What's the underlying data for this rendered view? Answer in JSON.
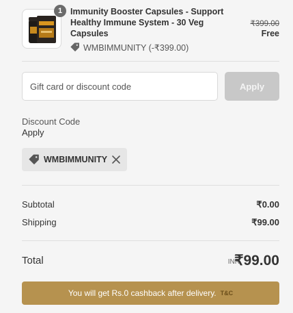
{
  "product": {
    "quantity": "1",
    "name": "Immunity Booster Capsules - Support Healthy Immune System - 30 Veg Capsules",
    "discount_line": "WMBIMMUNITY (-₹399.00)",
    "original_price": "₹399.00",
    "price": "Free"
  },
  "discount_form": {
    "placeholder": "Gift card or discount code",
    "value": "",
    "apply_label": "Apply"
  },
  "discount_section": {
    "label": "Discount Code",
    "sub_label": "Apply",
    "applied_code": "WMBIMMUNITY"
  },
  "summary": {
    "subtotal_label": "Subtotal",
    "subtotal_value": "₹0.00",
    "shipping_label": "Shipping",
    "shipping_value": "₹99.00",
    "total_label": "Total",
    "currency": "INR",
    "total_value": "₹99.00"
  },
  "cashback": {
    "message": "You will get Rs.0 cashback after delivery.",
    "tc_label": "T&C"
  },
  "colors": {
    "background": "#f5f5f5",
    "apply_button_disabled": "#c8c8c8",
    "cashback_banner": "#b6924f",
    "chip_background": "#e6e6e6"
  },
  "icons": {
    "discount_tag": "tag-icon",
    "remove_code": "close-icon"
  }
}
